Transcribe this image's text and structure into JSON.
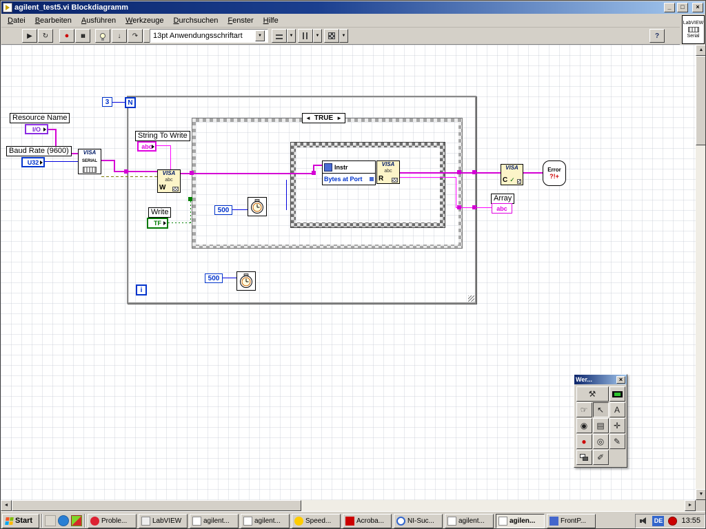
{
  "window": {
    "title": "agilent_test5.vi Blockdiagramm",
    "minimize": "_",
    "maximize": "□",
    "close": "×"
  },
  "vi_icon": {
    "top": "LabVIEW",
    "bottom": "Serial"
  },
  "menu": {
    "items": [
      "Datei",
      "Bearbeiten",
      "Ausführen",
      "Werkzeuge",
      "Durchsuchen",
      "Fenster",
      "Hilfe"
    ]
  },
  "toolbar": {
    "run": "▶",
    "continuous": "↻",
    "abort": "●",
    "pause": "▮▮",
    "step_into": "↓",
    "step_over": "↷",
    "step_out": "↑",
    "font": "13pt Anwendungsschriftart",
    "dropdown": "▼",
    "help": "?"
  },
  "diagram": {
    "loop": {
      "count_const": "3",
      "count": "N",
      "iter": "i"
    },
    "case": {
      "prev": "◄",
      "selector": "TRUE",
      "next": "►"
    },
    "resource": {
      "label": "Resource Name",
      "terminal": "I/O"
    },
    "baud": {
      "label": "Baud Rate (9600)",
      "terminal": "U32"
    },
    "visa_serial": {
      "brand": "VISA",
      "sub": "SERIAL"
    },
    "string_to_write": {
      "label": "String To Write",
      "terminal": "abc"
    },
    "visa_write": {
      "brand": "VISA",
      "mid": "abc",
      "pencil": "✎",
      "letter": "W"
    },
    "write": {
      "label": "Write",
      "terminal": "TF"
    },
    "prop": {
      "class": "Instr",
      "item": "Bytes at Port"
    },
    "visa_read": {
      "brand": "VISA",
      "mid": "abc",
      "letter": "R"
    },
    "visa_close": {
      "brand": "VISA",
      "letter": "C",
      "check": "✓"
    },
    "error": {
      "line1": "Error",
      "line2": "?!+"
    },
    "array": {
      "label": "Array",
      "terminal": "abc"
    },
    "wait_case": {
      "value": "500"
    },
    "wait_loop": {
      "value": "500"
    }
  },
  "palette": {
    "title": "Wer...",
    "close": "×",
    "auto": "⚒",
    "operate": "☞",
    "position": "↖",
    "text": "A",
    "wire": "◉",
    "menu": "▤",
    "scroll": "✛",
    "breakpoint": "●",
    "probe": "◎",
    "copy_color": "✎",
    "brush": "✐"
  },
  "scroll": {
    "up": "▲",
    "down": "▼",
    "left": "◄",
    "right": "►"
  },
  "taskbar": {
    "start": "Start",
    "tasks": [
      "Proble...",
      "LabVIEW",
      "agilent...",
      "agilent...",
      "Speed...",
      "Acroba...",
      "NI-Suc...",
      "agilent...",
      "agilen...",
      "FrontP..."
    ],
    "lang": "DE",
    "time": "13:55"
  }
}
